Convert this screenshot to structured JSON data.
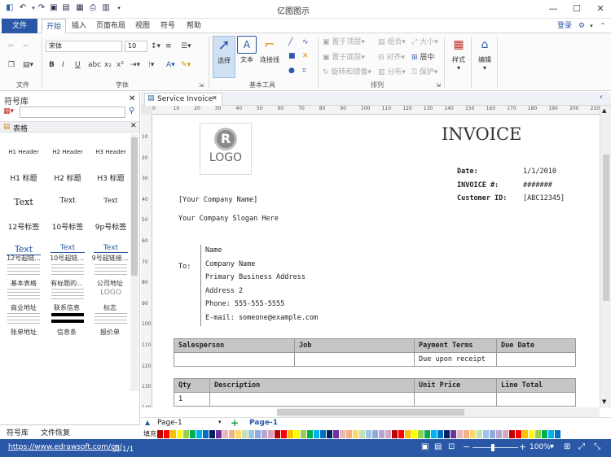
{
  "app": {
    "title": "亿图图示"
  },
  "tabs": {
    "file": "文件",
    "home": "开始",
    "insert": "插入",
    "layout": "页面布局",
    "view": "视图",
    "symbol": "符号",
    "help": "帮助",
    "login": "登录"
  },
  "ribbon": {
    "font_name": "宋体",
    "font_size": "10",
    "groups": {
      "file": "文件",
      "font": "字体",
      "basic_tools": "基本工具",
      "arrange": "排列"
    },
    "select": "选择",
    "text": "文本",
    "connector": "连接线",
    "bring_front": "置于顶层",
    "send_back": "置于底层",
    "rotate_mirror": "旋转和镜像",
    "group": "组合",
    "align": "对齐",
    "distribute": "分布",
    "size": "大小",
    "center": "居中",
    "protect": "保护",
    "style": "样式",
    "edit": "编辑"
  },
  "left_panel": {
    "title": "符号库",
    "section": "表格",
    "items": [
      {
        "preview": "H1 Header",
        "name": ""
      },
      {
        "preview": "H2 Header",
        "name": ""
      },
      {
        "preview": "H3 Header",
        "name": ""
      },
      {
        "preview": "H1 标题",
        "name": ""
      },
      {
        "preview": "H2 标题",
        "name": ""
      },
      {
        "preview": "H3 标题",
        "name": ""
      },
      {
        "preview": "Text",
        "name": ""
      },
      {
        "preview": "Text",
        "name": ""
      },
      {
        "preview": "Text",
        "name": ""
      },
      {
        "preview": "12号标签",
        "name": ""
      },
      {
        "preview": "10号标签",
        "name": ""
      },
      {
        "preview": "9p号标签",
        "name": ""
      },
      {
        "preview": "Text",
        "name": "12号超链..."
      },
      {
        "preview": "Text",
        "name": "10号超链..."
      },
      {
        "preview": "Text",
        "name": "9号超链接..."
      },
      {
        "preview": "",
        "name": "基本表格"
      },
      {
        "preview": "",
        "name": "有标题的..."
      },
      {
        "preview": "",
        "name": "公司地址"
      },
      {
        "preview": "",
        "name": "商业地址"
      },
      {
        "preview": "",
        "name": "联系信息"
      },
      {
        "preview": "LOGO",
        "name": "标志"
      },
      {
        "preview": "",
        "name": "账单地址"
      },
      {
        "preview": "",
        "name": "信息条"
      },
      {
        "preview": "",
        "name": "报价单"
      }
    ],
    "bottom_tab1": "符号库",
    "bottom_tab2": "文件恢复"
  },
  "document": {
    "tab_name": "Service Invoice",
    "logo_text": "LOGO",
    "invoice_title": "INVOICE",
    "date_label": "Date:",
    "date_value": "1/1/2010",
    "invoice_no_label": "INVOICE #:",
    "invoice_no_value": "#######",
    "customer_label": "Customer ID:",
    "customer_value": "[ABC12345]",
    "company_name": "[Your Company Name]",
    "slogan": "Your Company Slogan Here",
    "to_label": "To:",
    "to_lines": [
      "Name",
      "Company Name",
      "Primary Business Address",
      "Address 2",
      "Phone: 555-555-5555",
      "E-mail: someone@example.com"
    ],
    "table1_headers": [
      "Salesperson",
      "Job",
      "Payment Terms",
      "Due Date"
    ],
    "table1_row": [
      "",
      "",
      "Due upon receipt",
      ""
    ],
    "table2_headers": [
      "Qty",
      "Description",
      "Unit Price",
      "Line Total"
    ],
    "table2_row": [
      "1",
      "",
      "",
      ""
    ]
  },
  "ruler_h": [
    "0",
    "10",
    "20",
    "30",
    "40",
    "50",
    "60",
    "70",
    "80",
    "90",
    "100",
    "110",
    "120",
    "130",
    "140",
    "150",
    "160",
    "170",
    "180",
    "190",
    "200",
    "210"
  ],
  "ruler_v": [
    "10",
    "20",
    "30",
    "40",
    "50",
    "60",
    "70",
    "80",
    "90",
    "100",
    "110",
    "120",
    "130",
    "140"
  ],
  "pagebar": {
    "page_dropdown": "Page-1",
    "page_tab": "Page-1",
    "fill_label": "填充"
  },
  "status": {
    "url": "https://www.edrawsoft.com/cn/",
    "page": "页 1/1",
    "zoom": "100%"
  },
  "colors": {
    "accent": "#2a58a6",
    "palette": [
      "#c00000",
      "#ff0000",
      "#ffc000",
      "#ffff00",
      "#92d050",
      "#00b050",
      "#00b0f0",
      "#0070c0",
      "#002060",
      "#7030a0",
      "#e6b8b7",
      "#f4b183",
      "#ffd966",
      "#c5e0b4",
      "#9dc3e6",
      "#8faadc",
      "#b4a7d6",
      "#d5a6bd"
    ]
  }
}
